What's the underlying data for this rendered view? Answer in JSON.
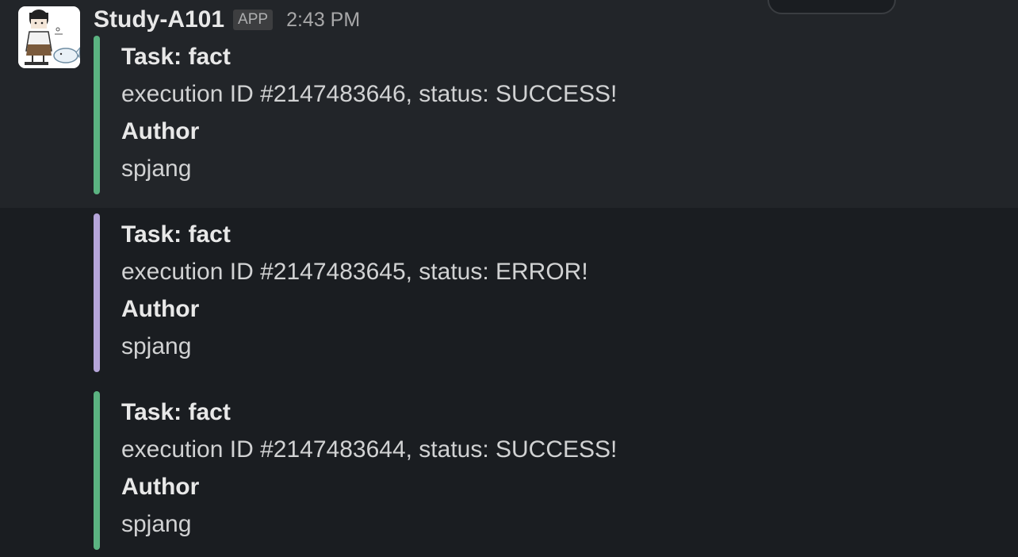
{
  "message": {
    "sender": "Study-A101",
    "badge": "APP",
    "time": "2:43 PM",
    "avatar": "avatar-illustration-icon"
  },
  "attachments": [
    {
      "task": "Task: fact",
      "execution": "execution ID #2147483646, status: SUCCESS!",
      "author_label": "Author",
      "author": "spjang",
      "color": "#5bb381"
    },
    {
      "task": "Task: fact",
      "execution": "execution ID #2147483645, status: ERROR!",
      "author_label": "Author",
      "author": "spjang",
      "color": "#b5a5d9"
    },
    {
      "task": "Task: fact",
      "execution": "execution ID #2147483644, status: SUCCESS!",
      "author_label": "Author",
      "author": "spjang",
      "color": "#5bb381"
    }
  ]
}
